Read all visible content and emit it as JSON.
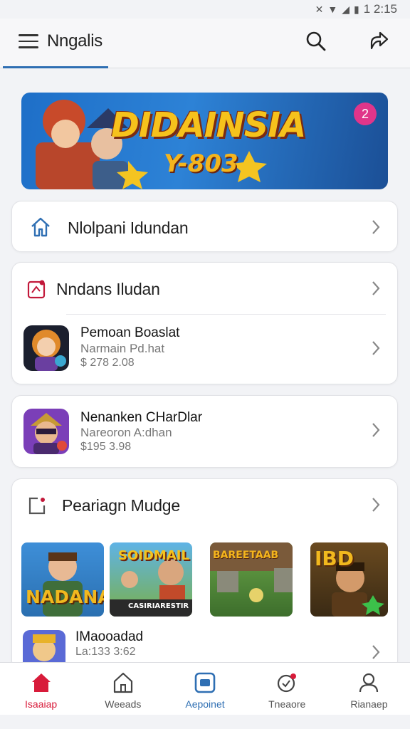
{
  "status": {
    "time": "1 2:15"
  },
  "header": {
    "title": "Nngalis"
  },
  "banner": {
    "title": "DIDAINSIA",
    "subtitle": "Y-803",
    "badge": "2"
  },
  "home_row": {
    "label": "Nlolpani Idundan"
  },
  "recent_section": {
    "title": "Nndans Iludan",
    "games": [
      {
        "name": "Pemoan Boaslat",
        "developer": "Narmain Pd.hat",
        "price": "$ 278 2.08"
      }
    ]
  },
  "featured_game": {
    "name": "Nenanken CHarDlar",
    "developer": "Nareoron A:dhan",
    "price": "$195 3.98"
  },
  "promo_section": {
    "title": "Peariagn Mudge",
    "thumbnails": [
      {
        "caption": "NADANAS"
      },
      {
        "caption": "SOIDMAIL",
        "sub_caption": "CASIRIARESTIR"
      },
      {
        "caption": "BAREETAAB"
      },
      {
        "caption": "IBD"
      }
    ],
    "game": {
      "name": "IMaooadad",
      "price": "La:133 3:62"
    }
  },
  "bottom_nav": [
    {
      "label": "Isaaiap",
      "icon": "home-icon"
    },
    {
      "label": "Weeads",
      "icon": "house-outline-icon"
    },
    {
      "label": "Aepoinet",
      "icon": "app-store-icon"
    },
    {
      "label": "Tneaore",
      "icon": "notification-icon"
    },
    {
      "label": "Rianaep",
      "icon": "profile-icon"
    }
  ],
  "colors": {
    "accent_red": "#d81b3a",
    "accent_blue": "#2f6fb3",
    "badge_pink": "#e0358a",
    "banner_blue": "#2d82d6"
  }
}
